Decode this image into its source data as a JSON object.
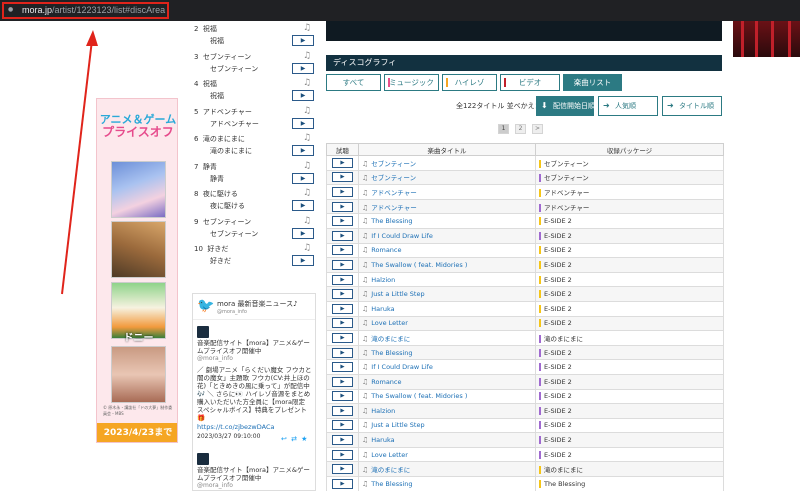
{
  "address_bar": {
    "host": "mora.jp",
    "path": "/artist/1223123/list#discArea"
  },
  "banner": {
    "title_line1": "アニメ＆ゲーム",
    "title_line2": "プライスオフ",
    "image3_caption": "ドニー",
    "note": "© 原木永・講談社「ドの大夢」制作委員会・MBS",
    "date": "2023/4/23まで"
  },
  "tracklist": [
    {
      "num": "2",
      "title": "祝福",
      "sub": "祝福"
    },
    {
      "num": "3",
      "title": "セブンティーン",
      "sub": "セブンティーン"
    },
    {
      "num": "4",
      "title": "祝福",
      "sub": "祝福"
    },
    {
      "num": "5",
      "title": "アドベンチャー",
      "sub": "アドベンチャー"
    },
    {
      "num": "6",
      "title": "滝のまにまに",
      "sub": "滝のまにまに"
    },
    {
      "num": "7",
      "title": "静青",
      "sub": "静青"
    },
    {
      "num": "8",
      "title": "夜に駆ける",
      "sub": "夜に駆ける"
    },
    {
      "num": "9",
      "title": "セブンティーン",
      "sub": "セブンティーン"
    },
    {
      "num": "10",
      "title": "好きだ",
      "sub": "好きだ"
    }
  ],
  "play_symbol": "▶",
  "note_symbol": "♫",
  "twitter": {
    "name": "mora 最新音楽ニュース♪",
    "handle": "@mora_info",
    "tweet1_title": "音楽配信サイト【mora】アニメ&ゲームプライスオフ開催中",
    "tweet1_handle": "@mora_info",
    "tweet1_body": "／ 劇場アニメ「らくだい魔女 フウカと闇の魔女」主題歌 フウカ(CV:井上ほの花)「ときめきの風に乗って」が配信中🎶 ＼ さらに👀 ハイレゾ音源をまとめ購入いただいた方全員に【mora限定 スペシャルボイス】特典をプレゼント🎁",
    "tweet1_link": "https://t.co/zjbezwDACa",
    "tweet1_time": "2023/03/27 09:10:00",
    "tweet_actions": "↩ ⇄ ★",
    "tweet2_title": "音楽配信サイト【mora】アニメ&ゲームプライスオフ開催中",
    "tweet2_handle": "@mora_info"
  },
  "discography": {
    "header": "ディスコグラフィ",
    "tabs": [
      {
        "label": "すべて",
        "stripe": ""
      },
      {
        "label": "ミュージック",
        "stripe": "#e8508b"
      },
      {
        "label": "ハイレゾ",
        "stripe": "#f5a623"
      },
      {
        "label": "ビデオ",
        "stripe": "#c0202a"
      },
      {
        "label": "楽曲リスト",
        "stripe": ""
      }
    ],
    "sort_label": "全122タイトル 並べかえ：",
    "sort_options": [
      "配信開始日順",
      "人気順",
      "タイトル順"
    ],
    "pages": [
      "1",
      "2",
      ">"
    ]
  },
  "song_table": {
    "headers": [
      "試聴",
      "楽曲タイトル",
      "収録パッケージ"
    ],
    "rows": [
      {
        "title": "セブンティーン",
        "package": "セブンティーン",
        "mark": "#f5c518"
      },
      {
        "title": "セブンティーン",
        "package": "セブンティーン",
        "mark": "#a06ad0"
      },
      {
        "title": "アドベンチャー",
        "package": "アドベンチャー",
        "mark": "#f5c518"
      },
      {
        "title": "アドベンチャー",
        "package": "アドベンチャー",
        "mark": "#a06ad0"
      },
      {
        "title": "The Blessing",
        "package": "E-SIDE 2",
        "mark": "#f5c518"
      },
      {
        "title": "If I Could Draw Life",
        "package": "E-SIDE 2",
        "mark": "#a06ad0"
      },
      {
        "title": "Romance",
        "package": "E-SIDE 2",
        "mark": "#f5c518"
      },
      {
        "title": "The Swallow ( feat. Midories )",
        "package": "E-SIDE 2",
        "mark": "#f5c518"
      },
      {
        "title": "Halzion",
        "package": "E-SIDE 2",
        "mark": "#f5c518"
      },
      {
        "title": "Just a Little Step",
        "package": "E-SIDE 2",
        "mark": "#f5c518"
      },
      {
        "title": "Haruka",
        "package": "E-SIDE 2",
        "mark": "#f5c518"
      },
      {
        "title": "Love Letter",
        "package": "E-SIDE 2",
        "mark": "#f5c518"
      },
      {
        "title": "滝のまにまに",
        "package": "滝のまにまに",
        "mark": "#a06ad0"
      },
      {
        "title": "The Blessing",
        "package": "E-SIDE 2",
        "mark": "#a06ad0"
      },
      {
        "title": "If I Could Draw Life",
        "package": "E-SIDE 2",
        "mark": "#a06ad0"
      },
      {
        "title": "Romance",
        "package": "E-SIDE 2",
        "mark": "#a06ad0"
      },
      {
        "title": "The Swallow ( feat. Midories )",
        "package": "E-SIDE 2",
        "mark": "#a06ad0"
      },
      {
        "title": "Halzion",
        "package": "E-SIDE 2",
        "mark": "#a06ad0"
      },
      {
        "title": "Just a Little Step",
        "package": "E-SIDE 2",
        "mark": "#a06ad0"
      },
      {
        "title": "Haruka",
        "package": "E-SIDE 2",
        "mark": "#a06ad0"
      },
      {
        "title": "Love Letter",
        "package": "E-SIDE 2",
        "mark": "#a06ad0"
      },
      {
        "title": "滝のまにまに",
        "package": "滝のまにまに",
        "mark": "#f5c518"
      },
      {
        "title": "The Blessing",
        "package": "The Blessing",
        "mark": "#f5c518"
      }
    ]
  },
  "colors": {
    "accent_teal": "#2c7a83",
    "link_blue": "#1b6fb5",
    "annotation_red": "#e0241b"
  }
}
